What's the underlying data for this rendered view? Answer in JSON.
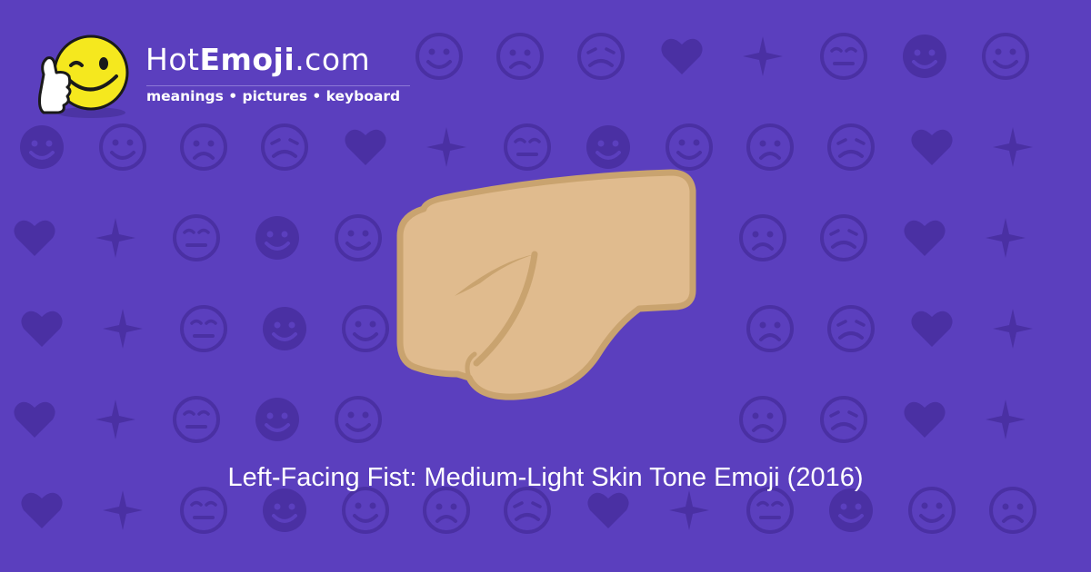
{
  "site": {
    "name_prefix": "Hot",
    "name_bold": "Emoji",
    "name_suffix": ".com",
    "tagline": "meanings • pictures • keyboard"
  },
  "caption": "Left-Facing Fist: Medium-Light Skin Tone Emoji (2016)",
  "colors": {
    "background": "#5b3fbe",
    "pattern": "#4a30a3",
    "fist_fill": "#e0bb8e",
    "fist_outline": "#c9a36f",
    "mascot_yellow": "#f5e81e",
    "text": "#ffffff"
  },
  "icons": {
    "mascot": "thumbs-up-winking-face-icon",
    "main": "left-facing-fist-icon",
    "pattern": "emoji-face-icon"
  }
}
